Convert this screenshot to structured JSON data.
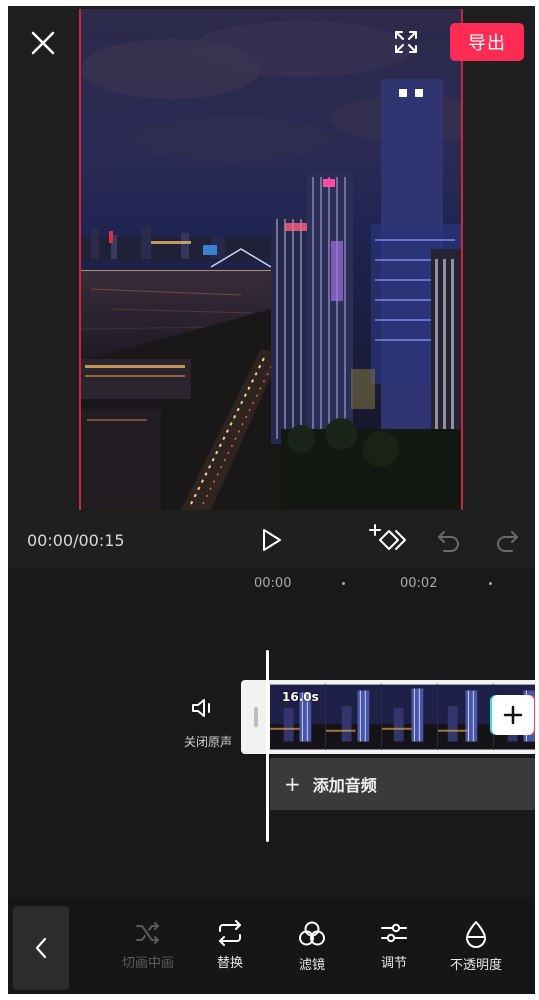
{
  "header": {
    "export_label": "导出"
  },
  "player": {
    "timecode": "00:00/00:15"
  },
  "timeline": {
    "ruler": [
      "00:00",
      "00:02"
    ],
    "mute_label": "关闭原声",
    "clip_duration": "16.0s",
    "add_audio_label": "添加音频",
    "add_audio_plus": "+"
  },
  "toolbar": {
    "tools": [
      {
        "label": "切画中画",
        "icon": "shuffle-icon",
        "enabled": false
      },
      {
        "label": "替换",
        "icon": "replace-icon",
        "enabled": true
      },
      {
        "label": "滤镜",
        "icon": "filter-icon",
        "enabled": true
      },
      {
        "label": "调节",
        "icon": "adjust-icon",
        "enabled": true
      },
      {
        "label": "不透明度",
        "icon": "opacity-icon",
        "enabled": true
      }
    ]
  },
  "colors": {
    "accent": "#fe2c55",
    "background": "#1f1f1f",
    "timeline_bg": "#191919",
    "toolbar_bg": "#161616"
  }
}
